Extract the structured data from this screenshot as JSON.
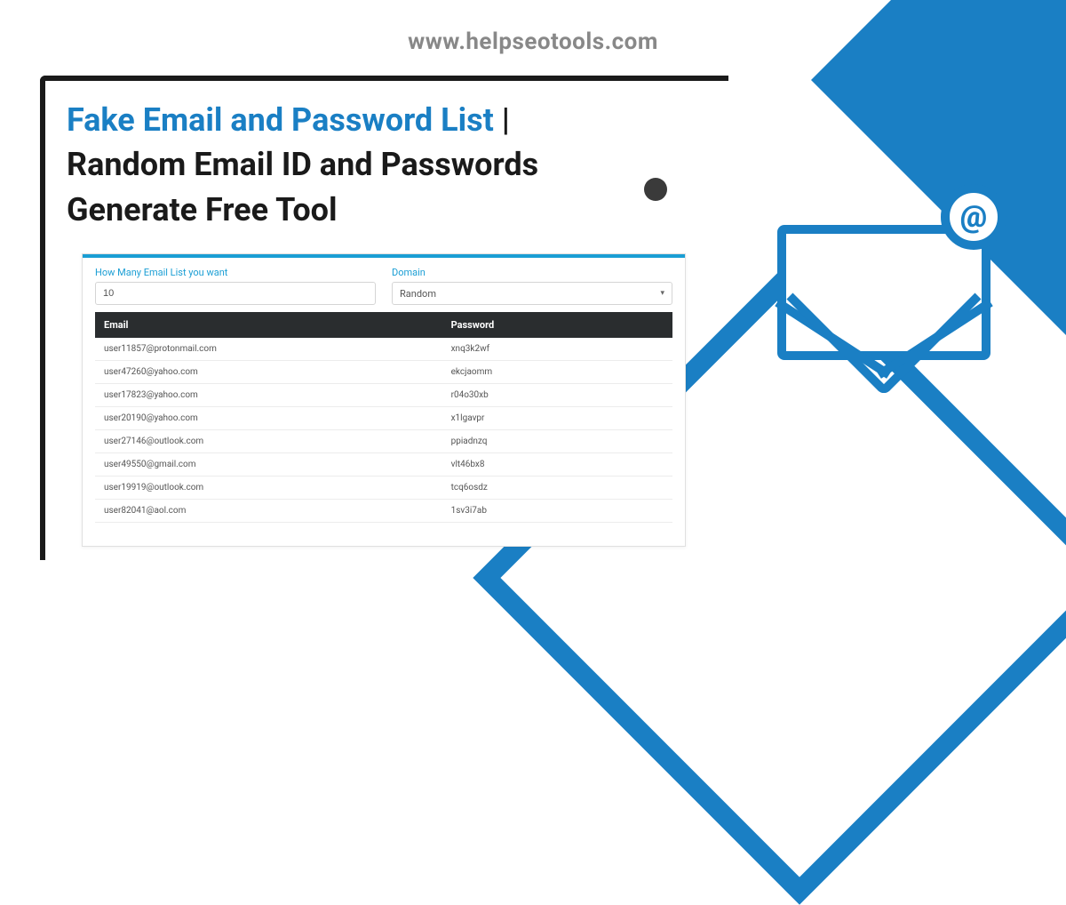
{
  "site_url": "www.helpseotools.com",
  "title": {
    "accent": "Fake Email and Password List",
    "separator": " | ",
    "rest": "Random Email ID and Passwords Generate Free Tool"
  },
  "form": {
    "count_label": "How Many Email List you want",
    "count_value": "10",
    "domain_label": "Domain",
    "domain_value": "Random"
  },
  "table": {
    "headers": {
      "email": "Email",
      "password": "Password"
    },
    "rows": [
      {
        "email": "user11857@protonmail.com",
        "password": "xnq3k2wf"
      },
      {
        "email": "user47260@yahoo.com",
        "password": "ekcjaomm"
      },
      {
        "email": "user17823@yahoo.com",
        "password": "r04o30xb"
      },
      {
        "email": "user20190@yahoo.com",
        "password": "x1lgavpr"
      },
      {
        "email": "user27146@outlook.com",
        "password": "ppiadnzq"
      },
      {
        "email": "user49550@gmail.com",
        "password": "vlt46bx8"
      },
      {
        "email": "user19919@outlook.com",
        "password": "tcq6osdz"
      },
      {
        "email": "user82041@aol.com",
        "password": "1sv3i7ab"
      }
    ]
  },
  "at_symbol": "@"
}
